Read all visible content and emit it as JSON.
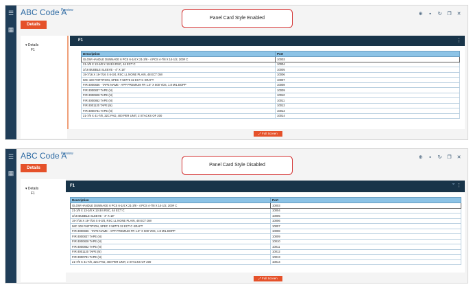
{
  "screens": [
    {
      "app_title": "ABC Code A",
      "preview_badge": "Preview",
      "details_button": "Details",
      "callout": "Panel Card Style Enabled",
      "nav_root": "Details",
      "nav_child": "F1",
      "panel_title": "F1",
      "columns": [
        "Description",
        "Port"
      ],
      "full_screen_button": "Full Screen"
    },
    {
      "app_title": "ABC Code A",
      "preview_badge": "Preview",
      "details_button": "Details",
      "callout": "Panel Card Style Disabled",
      "nav_root": "Details",
      "nav_child": "F1",
      "panel_title": "F1",
      "columns": [
        "Description",
        "Port"
      ],
      "full_screen_button": "Full Screen"
    }
  ],
  "rows": [
    [
      "GLOW HANDLE DUNNAGE 6 PCS 6-1/4 X 21-3/8 - 4 PCS 4-7/8 X 14-1/2, 200# C",
      "10003"
    ],
    [
      "21-1/8 X 13-1/8 X 13-3/4 RSC, 44 ECT C",
      "10004"
    ],
    [
      "3/16 BUBBLE SLEEVE - 4\" X 18\"",
      "10005"
    ],
    [
      "19-7/16 X 19-7/16 X 6-3/4, RSC LL NONE PLAIN, 48 ECT DW",
      "10006"
    ],
    [
      "IMC 100 PARTITION, SPEC # 58775 32 ECT C KRAFT",
      "10007"
    ],
    [
      "FIR-3000836 - TAPE NAME - APP PREMIUM FR 1.5\" X 500 YDS, 1.8 MIL BOPP",
      "10008"
    ],
    [
      "FIR-3000837 TAPE (N)",
      "10009"
    ],
    [
      "FIR-3000828 TAPE (N)",
      "10010"
    ],
    [
      "FIR-3000862 TAPE (N)",
      "10011"
    ],
    [
      "FIR-3001120 TAPE (N)",
      "10012"
    ],
    [
      "FIR-3000781 TAPE (N)",
      "10013"
    ],
    [
      "21-7/8 X 41-7/8, 32C PAD, 400 PER UNIT, 2 STACKS OF 200",
      "10014"
    ]
  ],
  "icons": {
    "rail": [
      "menu-icon",
      "apps-grid-icon"
    ],
    "toolbar": [
      "add-icon",
      "save-icon",
      "refresh-icon",
      "copy-icon",
      "close-icon"
    ]
  },
  "colors": {
    "accent": "#e5512a",
    "header": "#183449",
    "rail": "#1f3d58",
    "table_header": "#8cc3e6",
    "title": "#2d6aa3"
  }
}
